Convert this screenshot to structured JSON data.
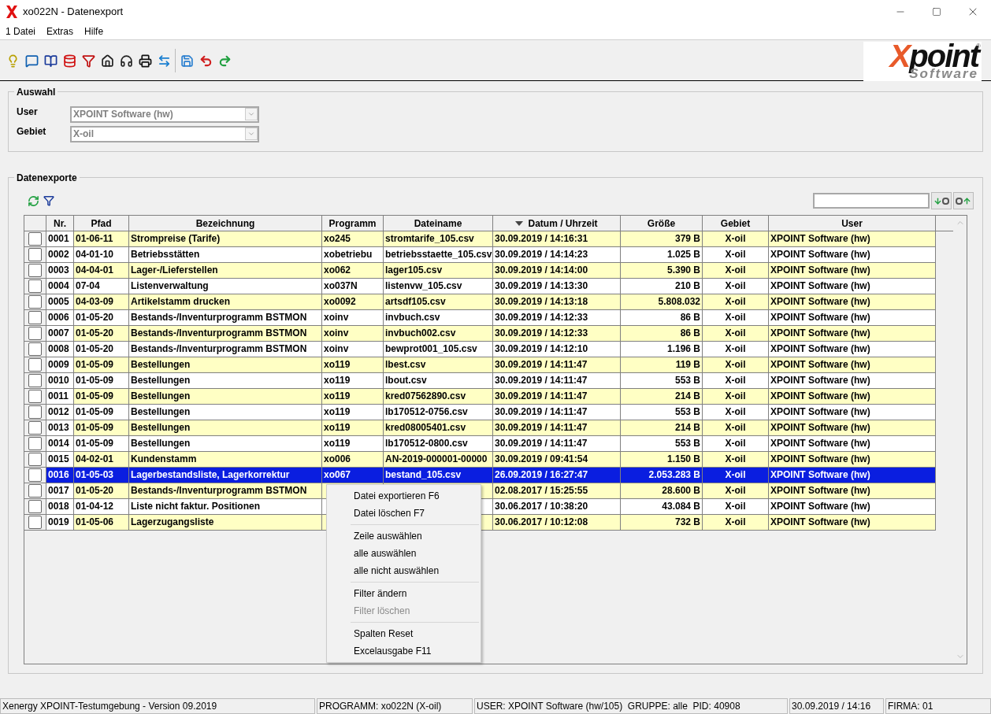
{
  "window": {
    "title": "xo022N - Datenexport"
  },
  "menu": [
    "1 Datei",
    "Extras",
    "Hilfe"
  ],
  "logo": {
    "word": "Xpoint",
    "sub": "Software",
    "mark": "®"
  },
  "auswahl": {
    "title": "Auswahl",
    "fields": [
      {
        "label": "User",
        "value": "XPOINT Software (hw)",
        "disabled": true
      },
      {
        "label": "Gebiet",
        "value": "X-oil",
        "disabled": true
      }
    ]
  },
  "datenexporte": {
    "title": "Datenexporte",
    "columns": [
      {
        "label": "Nr.",
        "sorted": false
      },
      {
        "label": "Pfad",
        "sorted": false
      },
      {
        "label": "Bezeichnung",
        "sorted": false
      },
      {
        "label": "Programm",
        "sorted": false
      },
      {
        "label": "Dateiname",
        "sorted": false
      },
      {
        "label": "Datum / Uhrzeit",
        "sorted": true
      },
      {
        "label": "Größe",
        "sorted": false
      },
      {
        "label": "Gebiet",
        "sorted": false
      },
      {
        "label": "User",
        "sorted": false
      }
    ],
    "rows": [
      {
        "cells": [
          "0001",
          "01-06-11",
          "Strompreise (Tarife)",
          "xo245",
          "stromtarife_105.csv",
          "30.09.2019 / 14:16:31",
          "379 B",
          "X-oil",
          "XPOINT Software (hw)"
        ],
        "checked": false,
        "selected": false
      },
      {
        "cells": [
          "0002",
          "04-01-10",
          "Betriebsstätten",
          "xobetriebu",
          "betriebsstaette_105.csv",
          "30.09.2019 / 14:14:23",
          "1.025 B",
          "X-oil",
          "XPOINT Software (hw)"
        ],
        "checked": false,
        "selected": false
      },
      {
        "cells": [
          "0003",
          "04-04-01",
          "Lager-/Lieferstellen",
          "xo062",
          "lager105.csv",
          "30.09.2019 / 14:14:00",
          "5.390 B",
          "X-oil",
          "XPOINT Software (hw)"
        ],
        "checked": false,
        "selected": false
      },
      {
        "cells": [
          "0004",
          "07-04",
          "Listenverwaltung",
          "xo037N",
          "listenvw_105.csv",
          "30.09.2019 / 14:13:30",
          "210 B",
          "X-oil",
          "XPOINT Software (hw)"
        ],
        "checked": false,
        "selected": false
      },
      {
        "cells": [
          "0005",
          "04-03-09",
          "Artikelstamm drucken",
          "xo0092",
          "artsdf105.csv",
          "30.09.2019 / 14:13:18",
          "5.808.032",
          "X-oil",
          "XPOINT Software (hw)"
        ],
        "checked": false,
        "selected": false
      },
      {
        "cells": [
          "0006",
          "01-05-20",
          "Bestands-/Inventurprogramm BSTMON",
          "xoinv",
          "invbuch.csv",
          "30.09.2019 / 14:12:33",
          "86 B",
          "X-oil",
          "XPOINT Software (hw)"
        ],
        "checked": false,
        "selected": false
      },
      {
        "cells": [
          "0007",
          "01-05-20",
          "Bestands-/Inventurprogramm BSTMON",
          "xoinv",
          "invbuch002.csv",
          "30.09.2019 / 14:12:33",
          "86 B",
          "X-oil",
          "XPOINT Software (hw)"
        ],
        "checked": false,
        "selected": false
      },
      {
        "cells": [
          "0008",
          "01-05-20",
          "Bestands-/Inventurprogramm BSTMON",
          "xoinv",
          "bewprot001_105.csv",
          "30.09.2019 / 14:12:10",
          "1.196 B",
          "X-oil",
          "XPOINT Software (hw)"
        ],
        "checked": false,
        "selected": false
      },
      {
        "cells": [
          "0009",
          "01-05-09",
          "Bestellungen",
          "xo119",
          "lbest.csv",
          "30.09.2019 / 14:11:47",
          "119 B",
          "X-oil",
          "XPOINT Software (hw)"
        ],
        "checked": false,
        "selected": false
      },
      {
        "cells": [
          "0010",
          "01-05-09",
          "Bestellungen",
          "xo119",
          "lbout.csv",
          "30.09.2019 / 14:11:47",
          "553 B",
          "X-oil",
          "XPOINT Software (hw)"
        ],
        "checked": false,
        "selected": false
      },
      {
        "cells": [
          "0011",
          "01-05-09",
          "Bestellungen",
          "xo119",
          "kred07562890.csv",
          "30.09.2019 / 14:11:47",
          "214 B",
          "X-oil",
          "XPOINT Software (hw)"
        ],
        "checked": false,
        "selected": false
      },
      {
        "cells": [
          "0012",
          "01-05-09",
          "Bestellungen",
          "xo119",
          "lb170512-0756.csv",
          "30.09.2019 / 14:11:47",
          "553 B",
          "X-oil",
          "XPOINT Software (hw)"
        ],
        "checked": false,
        "selected": false
      },
      {
        "cells": [
          "0013",
          "01-05-09",
          "Bestellungen",
          "xo119",
          "kred08005401.csv",
          "30.09.2019 / 14:11:47",
          "214 B",
          "X-oil",
          "XPOINT Software (hw)"
        ],
        "checked": false,
        "selected": false
      },
      {
        "cells": [
          "0014",
          "01-05-09",
          "Bestellungen",
          "xo119",
          "lb170512-0800.csv",
          "30.09.2019 / 14:11:47",
          "553 B",
          "X-oil",
          "XPOINT Software (hw)"
        ],
        "checked": false,
        "selected": false
      },
      {
        "cells": [
          "0015",
          "04-02-01",
          "Kundenstamm",
          "xo006",
          "AN-2019-000001-00000",
          "30.09.2019 / 09:41:54",
          "1.150 B",
          "X-oil",
          "XPOINT Software (hw)"
        ],
        "checked": false,
        "selected": false
      },
      {
        "cells": [
          "0016",
          "01-05-03",
          "Lagerbestandsliste, Lagerkorrektur",
          "xo067",
          "bestand_105.csv",
          "26.09.2019 / 16:27:47",
          "2.053.283 B",
          "X-oil",
          "XPOINT Software (hw)"
        ],
        "checked": false,
        "selected": true
      },
      {
        "cells": [
          "0017",
          "01-05-20",
          "Bestands-/Inventurprogramm BSTMON",
          null,
          null,
          "02.08.2017 / 15:25:55",
          "28.600 B",
          "X-oil",
          "XPOINT Software (hw)"
        ],
        "checked": false,
        "selected": false
      },
      {
        "cells": [
          "0018",
          "01-04-12",
          "Liste nicht faktur. Positionen",
          null,
          null,
          "30.06.2017 / 10:38:20",
          "43.084 B",
          "X-oil",
          "XPOINT Software (hw)"
        ],
        "checked": false,
        "selected": false
      },
      {
        "cells": [
          "0019",
          "01-05-06",
          "Lagerzugangsliste",
          null,
          null,
          "30.06.2017 / 10:12:08",
          "732 B",
          "X-oil",
          "XPOINT Software (hw)"
        ],
        "checked": false,
        "selected": false
      }
    ]
  },
  "context_menu": [
    {
      "kind": "item",
      "label": "Datei exportieren F6",
      "disabled": false
    },
    {
      "kind": "item",
      "label": "Datei löschen F7",
      "disabled": false
    },
    {
      "kind": "separator"
    },
    {
      "kind": "item",
      "label": "Zeile auswählen",
      "disabled": false
    },
    {
      "kind": "item",
      "label": "alle auswählen",
      "disabled": false
    },
    {
      "kind": "item",
      "label": "alle nicht auswählen",
      "disabled": false
    },
    {
      "kind": "separator"
    },
    {
      "kind": "item",
      "label": "Filter ändern",
      "disabled": false
    },
    {
      "kind": "item",
      "label": "Filter löschen",
      "disabled": true
    },
    {
      "kind": "separator"
    },
    {
      "kind": "item",
      "label": "Spalten Reset",
      "disabled": false
    },
    {
      "kind": "item",
      "label": "Excelausgabe F11",
      "disabled": false
    }
  ],
  "status_bar": [
    "Xenergy XPOINT-Testumgebung - Version 09.2019",
    "PROGRAMM: xo022N (X-oil)",
    "USER: XPOINT Software (hw/105)  GRUPPE: alle  PID: 40908",
    "30.09.2019 / 14:16",
    "FIRMA: 01"
  ]
}
